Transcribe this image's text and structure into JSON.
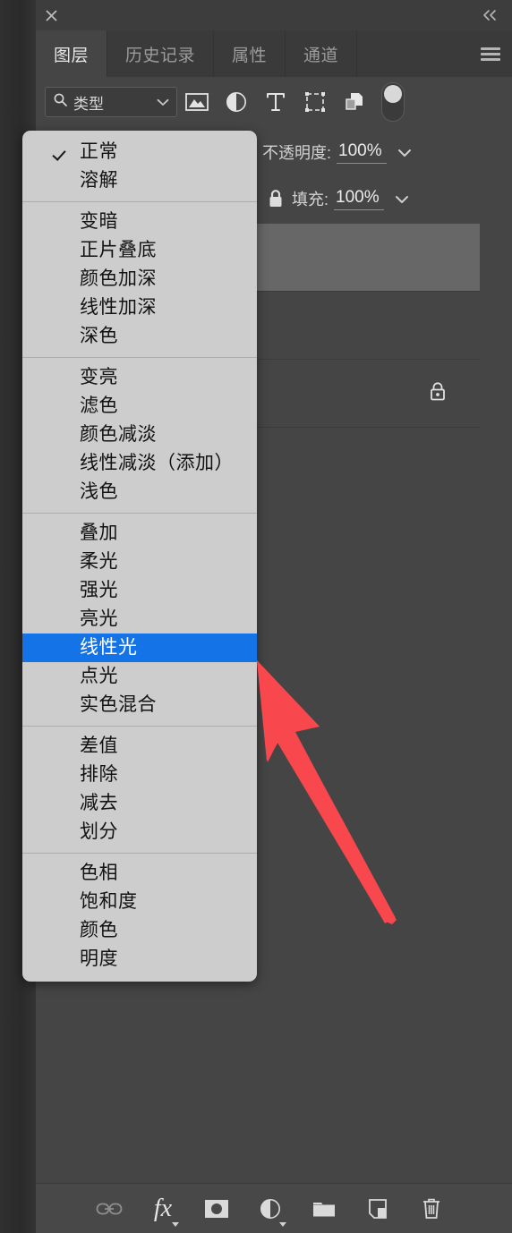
{
  "window": {
    "close_label": "×",
    "collapse_label": "«"
  },
  "tabs": [
    {
      "label": "图层",
      "active": true
    },
    {
      "label": "历史记录",
      "active": false
    },
    {
      "label": "属性",
      "active": false
    },
    {
      "label": "通道",
      "active": false
    }
  ],
  "panel_menu": {
    "icon": "hamburger-menu-icon"
  },
  "filter_bar": {
    "search_icon": "search-icon",
    "filter_type_label": "类型",
    "chevron": "chevron-down-icon",
    "icons": [
      "image-filter-icon",
      "adjustment-filter-icon",
      "type-filter-icon",
      "shape-filter-icon",
      "smart-object-filter-icon"
    ],
    "toggle": "filter-toggle-switch"
  },
  "properties": {
    "opacity_label": "不透明度:",
    "opacity_value": "100%",
    "fill_label": "填充:",
    "fill_value": "100%",
    "lock_icon": "lock-icon",
    "chevron": "chevron-down-icon"
  },
  "layers": [
    {
      "name": "layer-row-1",
      "selected": true,
      "locked": false
    },
    {
      "name": "layer-row-2",
      "selected": false,
      "locked": false
    },
    {
      "name": "layer-row-3",
      "selected": false,
      "locked": true
    }
  ],
  "blend_menu": {
    "selected": "正常",
    "highlighted": "线性光",
    "groups": [
      {
        "items": [
          "正常",
          "溶解"
        ]
      },
      {
        "items": [
          "变暗",
          "正片叠底",
          "颜色加深",
          "线性加深",
          "深色"
        ]
      },
      {
        "items": [
          "变亮",
          "滤色",
          "颜色减淡",
          "线性减淡（添加）",
          "浅色"
        ]
      },
      {
        "items": [
          "叠加",
          "柔光",
          "强光",
          "亮光",
          "线性光",
          "点光",
          "实色混合"
        ]
      },
      {
        "items": [
          "差值",
          "排除",
          "减去",
          "划分"
        ]
      },
      {
        "items": [
          "色相",
          "饱和度",
          "颜色",
          "明度"
        ]
      }
    ]
  },
  "bottom_bar": {
    "icons": [
      "link-layers-icon",
      "layer-style-fx-icon",
      "add-layer-mask-icon",
      "new-adjustment-layer-icon",
      "new-group-icon",
      "new-layer-icon",
      "delete-layer-icon"
    ],
    "fx_label": "fx"
  },
  "annotation": {
    "arrow": "red-pointer-arrow",
    "color": "#f8474d",
    "points_to": "线性光"
  },
  "colors": {
    "panel_bg": "#454545",
    "titlebar_bg": "#3d3d3d",
    "tabbar_bg": "#3a3a3a",
    "menu_bg": "#cdcdcd",
    "highlight_blue": "#1473e6",
    "arrow_red": "#f8474d"
  }
}
